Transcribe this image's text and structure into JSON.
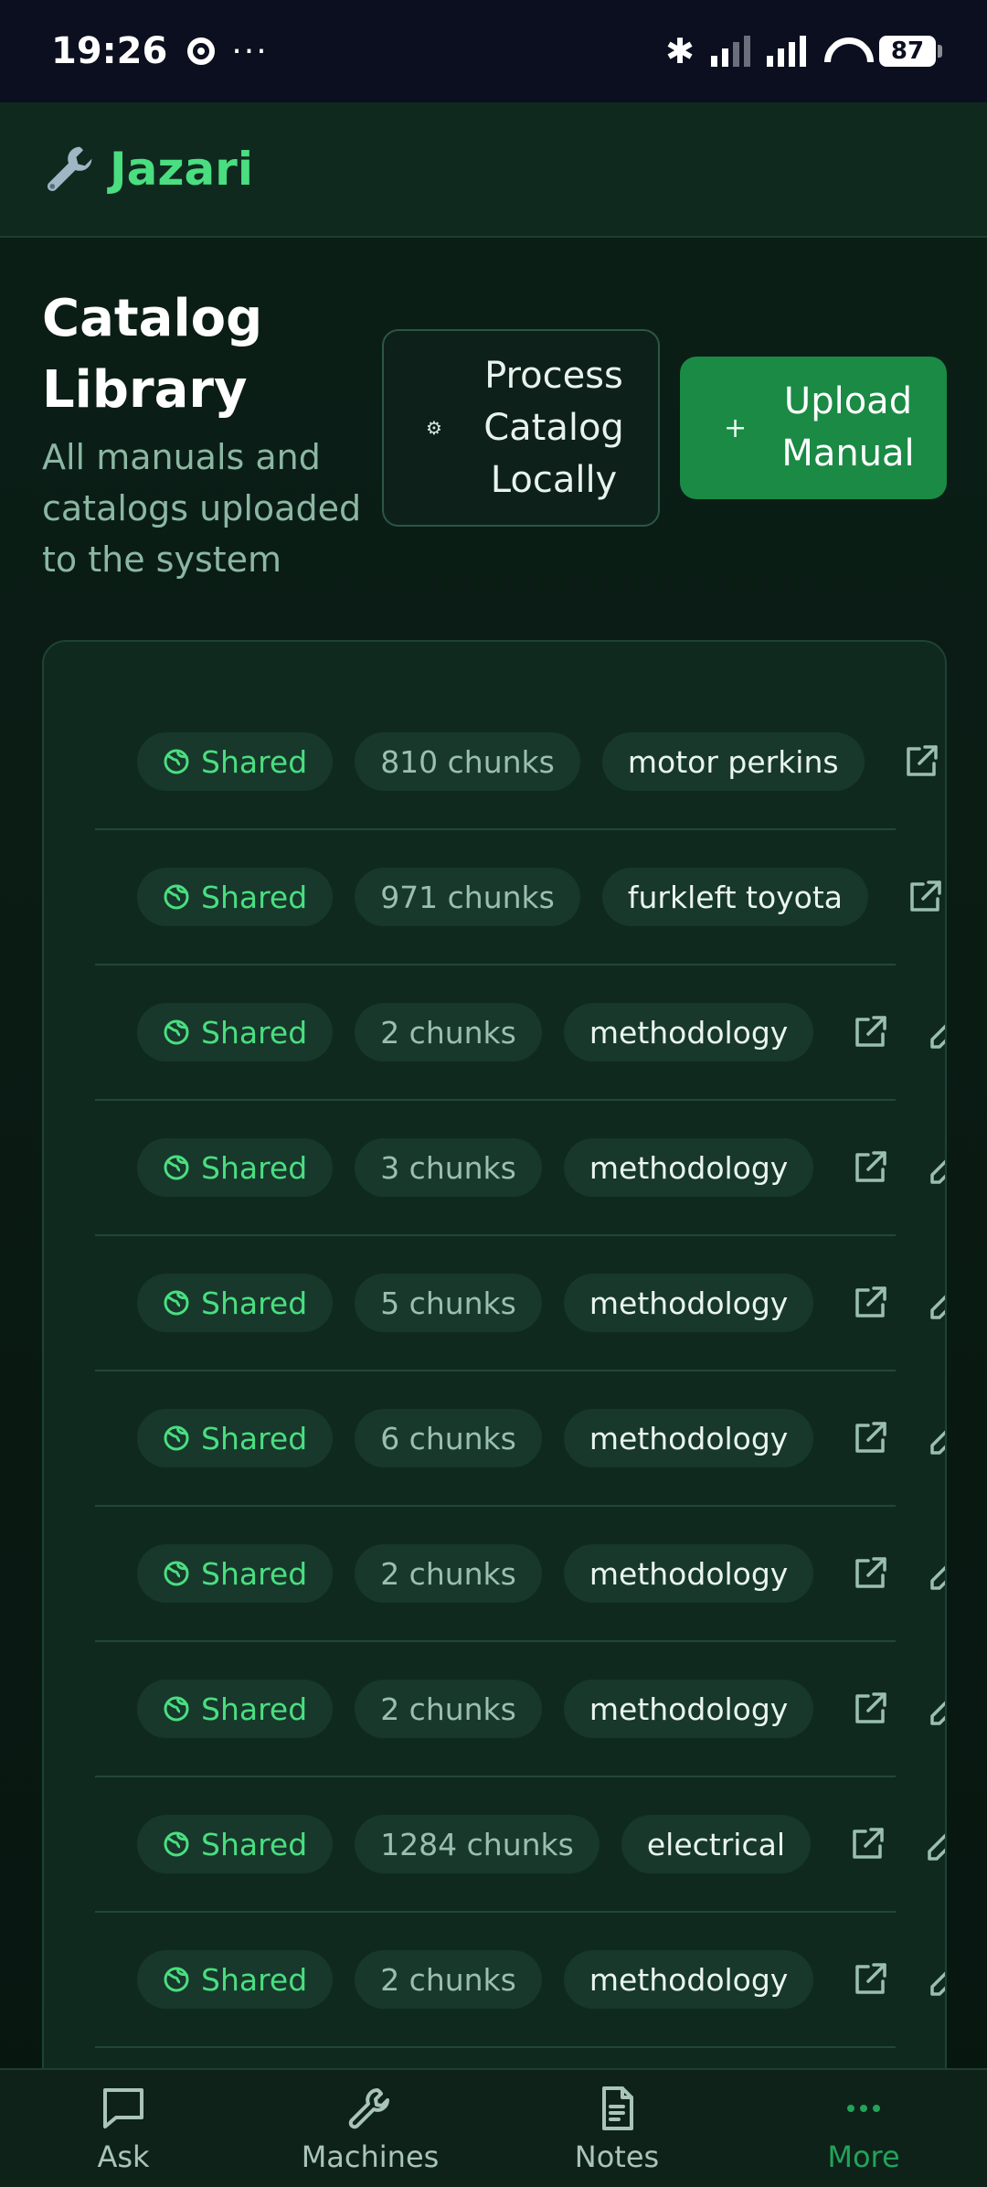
{
  "status_bar": {
    "time": "19:26",
    "dots": "···",
    "battery": "87"
  },
  "app": {
    "name": "Jazari",
    "brand_color": "#4ade80"
  },
  "header": {
    "title_line1": "Catalog",
    "title_line2": "Library",
    "subtitle": "All manuals and catalogs uploaded to the system"
  },
  "actions": {
    "process_icon": "⚙",
    "process_label": "Process Catalog Locally",
    "upload_icon": "+",
    "upload_label": "Upload Manual"
  },
  "catalogs": [
    {
      "visibility": "Shared",
      "chunks": "810 chunks",
      "tag": "motor perkins"
    },
    {
      "visibility": "Shared",
      "chunks": "971 chunks",
      "tag": "furkleft toyota"
    },
    {
      "visibility": "Shared",
      "chunks": "2 chunks",
      "tag": "methodology"
    },
    {
      "visibility": "Shared",
      "chunks": "3 chunks",
      "tag": "methodology"
    },
    {
      "visibility": "Shared",
      "chunks": "5 chunks",
      "tag": "methodology"
    },
    {
      "visibility": "Shared",
      "chunks": "6 chunks",
      "tag": "methodology"
    },
    {
      "visibility": "Shared",
      "chunks": "2 chunks",
      "tag": "methodology"
    },
    {
      "visibility": "Shared",
      "chunks": "2 chunks",
      "tag": "methodology"
    },
    {
      "visibility": "Shared",
      "chunks": "1284 chunks",
      "tag": "electrical"
    },
    {
      "visibility": "Shared",
      "chunks": "2 chunks",
      "tag": "methodology"
    }
  ],
  "bottom_nav": [
    {
      "label": "Ask",
      "icon": "chat-icon",
      "active": false
    },
    {
      "label": "Machines",
      "icon": "wrench-icon",
      "active": false
    },
    {
      "label": "Notes",
      "icon": "document-icon",
      "active": false
    },
    {
      "label": "More",
      "icon": "more-icon",
      "active": true
    }
  ]
}
